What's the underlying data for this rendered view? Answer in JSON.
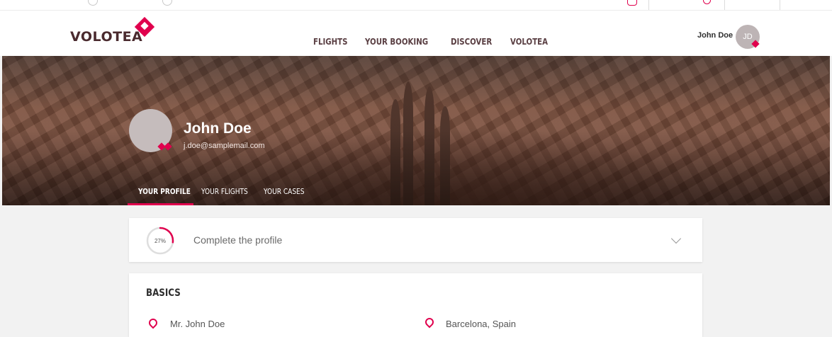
{
  "header": {
    "logo_text": "VOLOTEA",
    "nav": [
      "FLIGHTS",
      "YOUR BOOKING",
      "DISCOVER",
      "VOLOTEA"
    ],
    "user_name": "John Doe",
    "user_initials": "JD"
  },
  "profile": {
    "name": "John Doe",
    "email": "j.doe@samplemail.com",
    "tabs": [
      "YOUR PROFILE",
      "YOUR FLIGHTS",
      "YOUR CASES"
    ],
    "active_tab": "YOUR PROFILE"
  },
  "progress": {
    "percent_label": "27%",
    "percent_value": 27,
    "label": "Complete the profile"
  },
  "basics": {
    "title": "BASICS",
    "name_value": "Mr. John Doe",
    "location_value": "Barcelona, Spain"
  },
  "colors": {
    "accent": "#e0004d",
    "brand_text": "#4a2a2e"
  },
  "icons": [
    "bell-icon",
    "location-pin-icon",
    "chevron-down-icon",
    "diamond-badge-icon"
  ]
}
